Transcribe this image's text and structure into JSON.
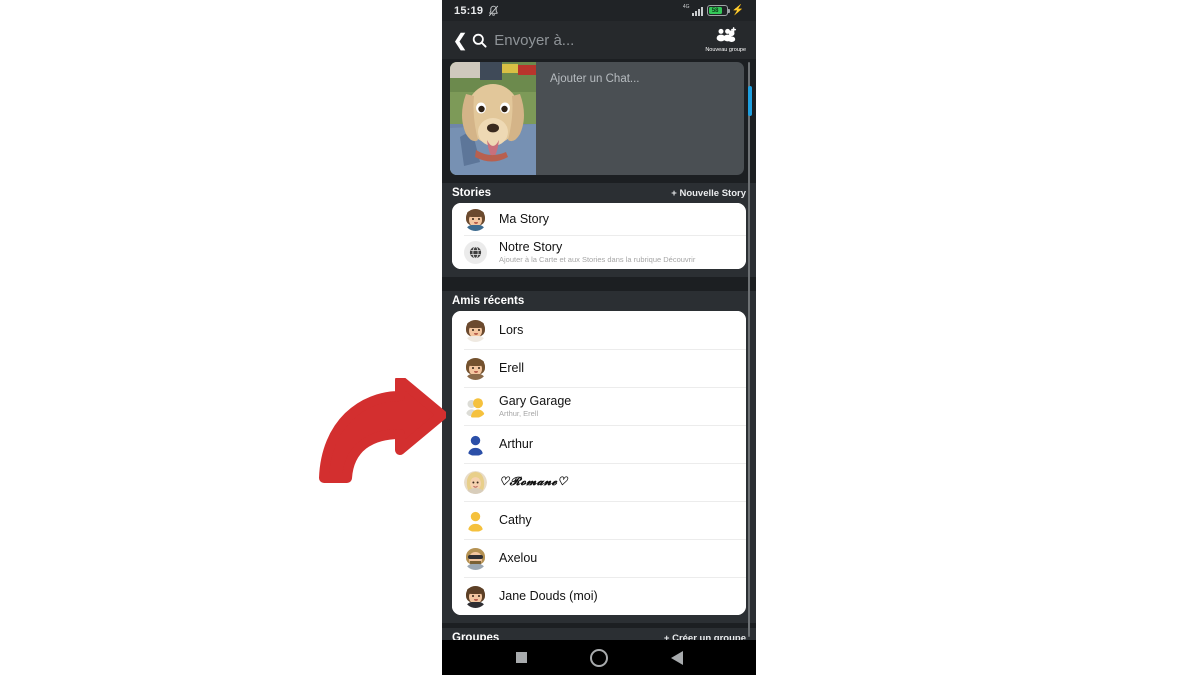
{
  "status_bar": {
    "time": "15:19",
    "bell_icon": "bell-muted-icon",
    "network_label": "4G",
    "battery_percent": "58",
    "charging_icon": "lightning-bolt-icon"
  },
  "header": {
    "back_icon": "back-chevron-icon",
    "search_icon": "search-icon",
    "search_placeholder": "Envoyer à...",
    "new_group_icon": "add-group-icon",
    "new_group_label": "Nouveau groupe"
  },
  "chat_card": {
    "thumbnail_alt": "dog-photo-thumbnail",
    "placeholder": "Ajouter un Chat..."
  },
  "stories": {
    "title": "Stories",
    "action_label": "+ Nouvelle Story",
    "items": [
      {
        "name": "Ma Story",
        "subtitle": "",
        "avatar": "bitmoji-brown-hair"
      },
      {
        "name": "Notre Story",
        "subtitle": "Ajouter à la Carte et aux Stories dans la rubrique Découvrir",
        "avatar": "globe-icon"
      }
    ]
  },
  "recent_friends": {
    "title": "Amis récents",
    "items": [
      {
        "name": "Lors",
        "subtitle": "",
        "avatar": "bitmoji-brown-hair"
      },
      {
        "name": "Erell",
        "subtitle": "",
        "avatar": "bitmoji-brown-hair"
      },
      {
        "name": "Gary Garage",
        "subtitle": "Arthur, Erell",
        "avatar": "group-silhouette-yellow"
      },
      {
        "name": "Arthur",
        "subtitle": "",
        "avatar": "silhouette-blue"
      },
      {
        "name": "♡𝓡𝓸𝓶𝓪𝓷𝓮♡",
        "subtitle": "",
        "avatar": "photo-blonde"
      },
      {
        "name": "Cathy",
        "subtitle": "",
        "avatar": "silhouette-yellow"
      },
      {
        "name": "Axelou",
        "subtitle": "",
        "avatar": "bitmoji-beard"
      },
      {
        "name": "Jane Douds (moi)",
        "subtitle": "",
        "avatar": "bitmoji-brown-hair"
      }
    ]
  },
  "groups": {
    "title": "Groupes",
    "action_label": "+ Créer un groupe"
  },
  "nav_bar": {
    "recents_icon": "square-icon",
    "home_icon": "circle-icon",
    "back_icon": "triangle-back-icon"
  },
  "annotation": {
    "arrow_color": "#d32f2f",
    "points_to": "Gary Garage"
  },
  "colors": {
    "page_background": "#ffffff",
    "phone_background": "#1c1f22",
    "section_background": "#2b2f33",
    "card_background": "#ffffff",
    "accent_scrollbar": "#1e9fe0",
    "battery_green": "#34c759"
  }
}
